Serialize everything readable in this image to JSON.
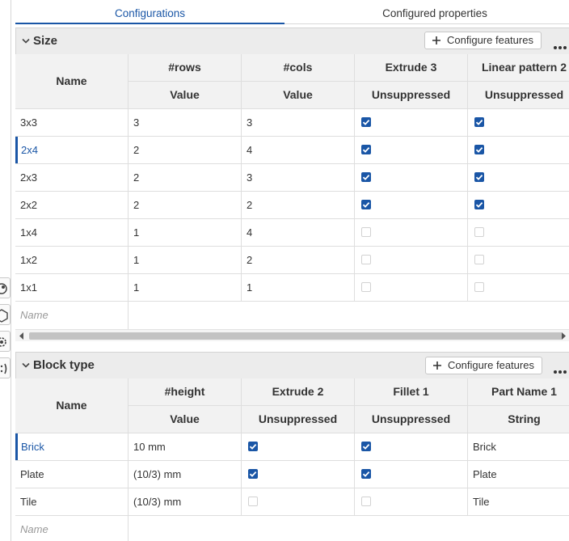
{
  "tabs": [
    {
      "label": "Configurations"
    },
    {
      "label": "Configured properties"
    }
  ],
  "configure_features_label": "Configure features",
  "name_placeholder": "Name",
  "size": {
    "title": "Size",
    "columns": [
      {
        "name": "Name",
        "sub": ""
      },
      {
        "name": "#rows",
        "sub": "Value"
      },
      {
        "name": "#cols",
        "sub": "Value"
      },
      {
        "name": "Extrude 3",
        "sub": "Unsuppressed"
      },
      {
        "name": "Linear pattern 2",
        "sub": "Unsuppressed"
      }
    ],
    "rows": [
      {
        "name": "3x3",
        "rows": "3",
        "cols": "3",
        "extrude3": true,
        "pattern2": true
      },
      {
        "name": "2x4",
        "rows": "2",
        "cols": "4",
        "extrude3": true,
        "pattern2": true,
        "active": true
      },
      {
        "name": "2x3",
        "rows": "2",
        "cols": "3",
        "extrude3": true,
        "pattern2": true
      },
      {
        "name": "2x2",
        "rows": "2",
        "cols": "2",
        "extrude3": true,
        "pattern2": true
      },
      {
        "name": "1x4",
        "rows": "1",
        "cols": "4",
        "extrude3": false,
        "pattern2": false
      },
      {
        "name": "1x2",
        "rows": "1",
        "cols": "2",
        "extrude3": false,
        "pattern2": false
      },
      {
        "name": "1x1",
        "rows": "1",
        "cols": "1",
        "extrude3": false,
        "pattern2": false
      }
    ]
  },
  "block_type": {
    "title": "Block type",
    "columns": [
      {
        "name": "Name",
        "sub": ""
      },
      {
        "name": "#height",
        "sub": "Value"
      },
      {
        "name": "Extrude 2",
        "sub": "Unsuppressed"
      },
      {
        "name": "Fillet 1",
        "sub": "Unsuppressed"
      },
      {
        "name": "Part Name 1",
        "sub": "String"
      }
    ],
    "rows": [
      {
        "name": "Brick",
        "height": "10 mm",
        "extrude2": true,
        "fillet1": true,
        "part_name": "Brick",
        "active": true
      },
      {
        "name": "Plate",
        "height": "(10/3) mm",
        "extrude2": true,
        "fillet1": true,
        "part_name": "Plate"
      },
      {
        "name": "Tile",
        "height": "(10/3) mm",
        "extrude2": false,
        "fillet1": false,
        "part_name": "Tile"
      }
    ]
  },
  "colors": {
    "accent": "#1a56a6",
    "header_bg": "#ececec"
  },
  "icons": [
    "chevron-down-icon",
    "plus-icon",
    "more-icon",
    "checkbox-icon",
    "scroll-left-icon",
    "scroll-right-icon"
  ]
}
